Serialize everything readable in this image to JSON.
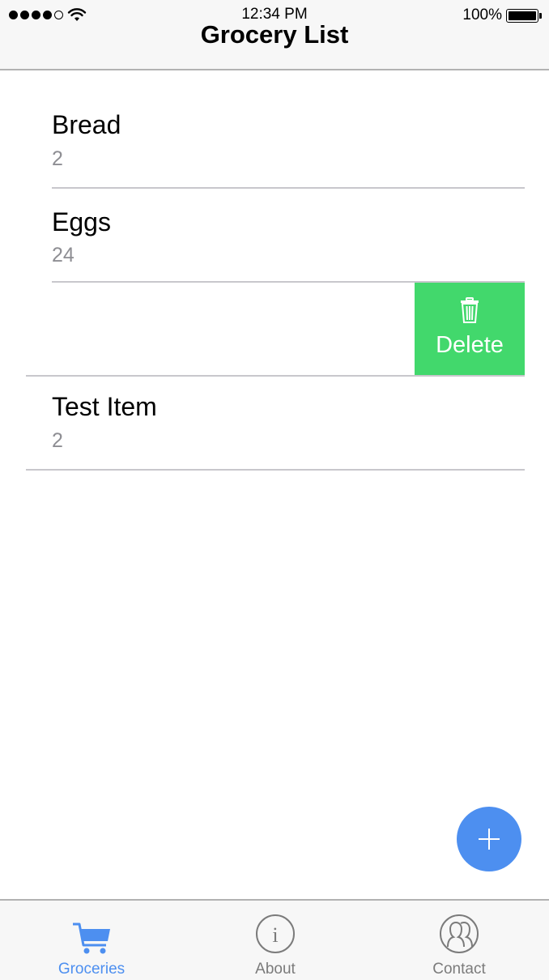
{
  "status_bar": {
    "time": "12:34 PM",
    "battery": "100%"
  },
  "header": {
    "title": "Grocery List"
  },
  "items": [
    {
      "name": "Bread",
      "quantity": "2"
    },
    {
      "name": "Eggs",
      "quantity": "24"
    },
    {
      "name": "",
      "quantity": ""
    },
    {
      "name": "Test Item",
      "quantity": "2"
    }
  ],
  "swipe_action": {
    "label": "Delete",
    "icon": "trash-icon",
    "color": "#42d86c"
  },
  "fab": {
    "icon": "plus-icon",
    "color": "#4d8ff0"
  },
  "tabs": [
    {
      "label": "Groceries",
      "icon": "cart-icon",
      "active": true
    },
    {
      "label": "About",
      "icon": "info-icon",
      "active": false
    },
    {
      "label": "Contact",
      "icon": "people-icon",
      "active": false
    }
  ],
  "colors": {
    "accent": "#4d8ff0",
    "secondary_text": "#8e8e93"
  }
}
